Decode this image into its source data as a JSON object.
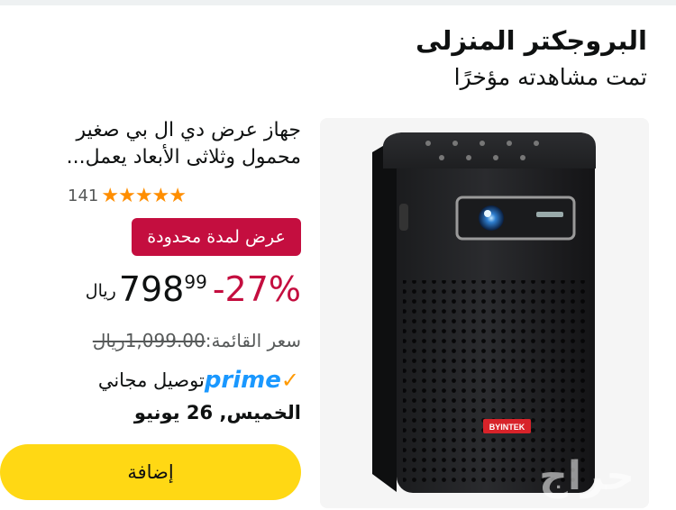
{
  "header": {
    "title": "البروجكتر المنزلى",
    "subtitle": "تمت مشاهدته مؤخرًا"
  },
  "product": {
    "title": "جهاز عرض دي ال بي صغير محمول وثلاثى الأبعاد يعمل...",
    "image_brand": "BYINTEK",
    "rating_stars": "★★★★★",
    "rating_value": 4.5,
    "rating_count": "141",
    "deal_badge": "عرض لمدة محدودة",
    "discount": "-27%",
    "price_whole": "798",
    "price_fraction": "99",
    "currency": "ريال",
    "list_price_label": "سعر القائمة:",
    "list_price_value": "1,099.00ريال",
    "prime_logo": "prime",
    "delivery_label": "توصيل مجاني",
    "delivery_date": "الخميس, 26 يونيو",
    "add_button": "إضافة"
  },
  "watermark": "حراج",
  "colors": {
    "deal_red": "#c40e3f",
    "star_orange": "#ff8e00",
    "prime_blue": "#1a98ff",
    "button_yellow": "#ffd814"
  }
}
